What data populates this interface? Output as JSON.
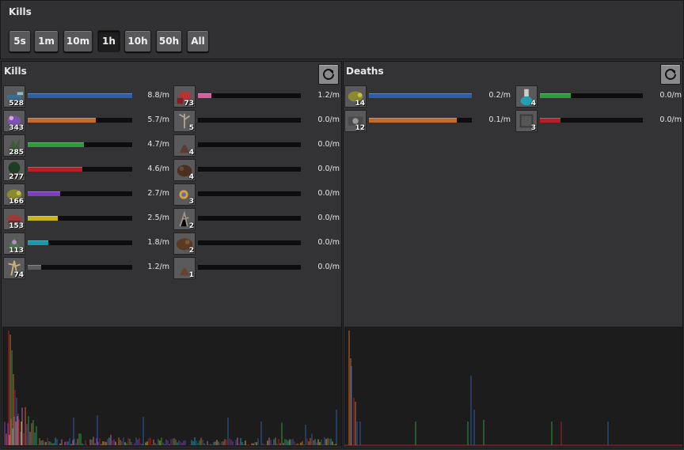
{
  "window": {
    "title": "Kills"
  },
  "time_buttons": [
    {
      "label": "5s",
      "active": false
    },
    {
      "label": "1m",
      "active": false
    },
    {
      "label": "10m",
      "active": false
    },
    {
      "label": "1h",
      "active": true
    },
    {
      "label": "10h",
      "active": false
    },
    {
      "label": "50h",
      "active": false
    },
    {
      "label": "All",
      "active": false
    }
  ],
  "kills": {
    "title": "Kills",
    "refresh_icon": "refresh-icon",
    "col1": [
      {
        "icon": "gun-turret-icon",
        "count": "528",
        "rate": "8.8/m",
        "color": "#2d5da6",
        "fill": 1.0
      },
      {
        "icon": "small-worm-icon",
        "count": "343",
        "rate": "5.7/m",
        "color": "#c26a2a",
        "fill": 0.65
      },
      {
        "icon": "small-biter-icon",
        "count": "285",
        "rate": "4.7/m",
        "color": "#2f9a3d",
        "fill": 0.54
      },
      {
        "icon": "tree-icon",
        "count": "277",
        "rate": "4.6/m",
        "color": "#b22028",
        "fill": 0.52
      },
      {
        "icon": "medium-biter-icon",
        "count": "166",
        "rate": "2.7/m",
        "color": "#7a3ec0",
        "fill": 0.31
      },
      {
        "icon": "small-spitter-icon",
        "count": "153",
        "rate": "2.5/m",
        "color": "#c9b51a",
        "fill": 0.29
      },
      {
        "icon": "medium-spitter-icon",
        "count": "113",
        "rate": "1.8/m",
        "color": "#1a9aa6",
        "fill": 0.2
      },
      {
        "icon": "dry-tree-icon",
        "count": "74",
        "rate": "1.2/m",
        "color": "#5c5c5c",
        "fill": 0.13
      }
    ],
    "col2": [
      {
        "icon": "character-icon",
        "count": "73",
        "rate": "1.2/m",
        "color": "#d05f9a",
        "fill": 0.13
      },
      {
        "icon": "dead-tree-icon",
        "count": "5",
        "rate": "0.0/m",
        "color": "#555555",
        "fill": 0
      },
      {
        "icon": "rock-icon",
        "count": "4",
        "rate": "0.0/m",
        "color": "#555555",
        "fill": 0
      },
      {
        "icon": "big-rock-icon",
        "count": "4",
        "rate": "0.0/m",
        "color": "#555555",
        "fill": 0
      },
      {
        "icon": "flare-icon",
        "count": "3",
        "rate": "0.0/m",
        "color": "#555555",
        "fill": 0
      },
      {
        "icon": "dead-bush-icon",
        "count": "2",
        "rate": "0.0/m",
        "color": "#555555",
        "fill": 0
      },
      {
        "icon": "huge-rock-icon",
        "count": "2",
        "rate": "0.0/m",
        "color": "#555555",
        "fill": 0
      },
      {
        "icon": "sand-rock-icon",
        "count": "1",
        "rate": "0.0/m",
        "color": "#555555",
        "fill": 0
      }
    ]
  },
  "deaths": {
    "title": "Deaths",
    "refresh_icon": "refresh-icon",
    "col1": [
      {
        "icon": "medium-biter-icon",
        "count": "14",
        "rate": "0.2/m",
        "color": "#2d5da6",
        "fill": 1.0
      },
      {
        "icon": "tank-icon",
        "count": "12",
        "rate": "0.1/m",
        "color": "#c26a2a",
        "fill": 0.85
      }
    ],
    "col2": [
      {
        "icon": "flask-icon",
        "count": "4",
        "rate": "0.0/m",
        "color": "#2f9a3d",
        "fill": 0.3
      },
      {
        "icon": "wall-icon",
        "count": "3",
        "rate": "0.0/m",
        "color": "#b22028",
        "fill": 0.2
      }
    ]
  }
}
